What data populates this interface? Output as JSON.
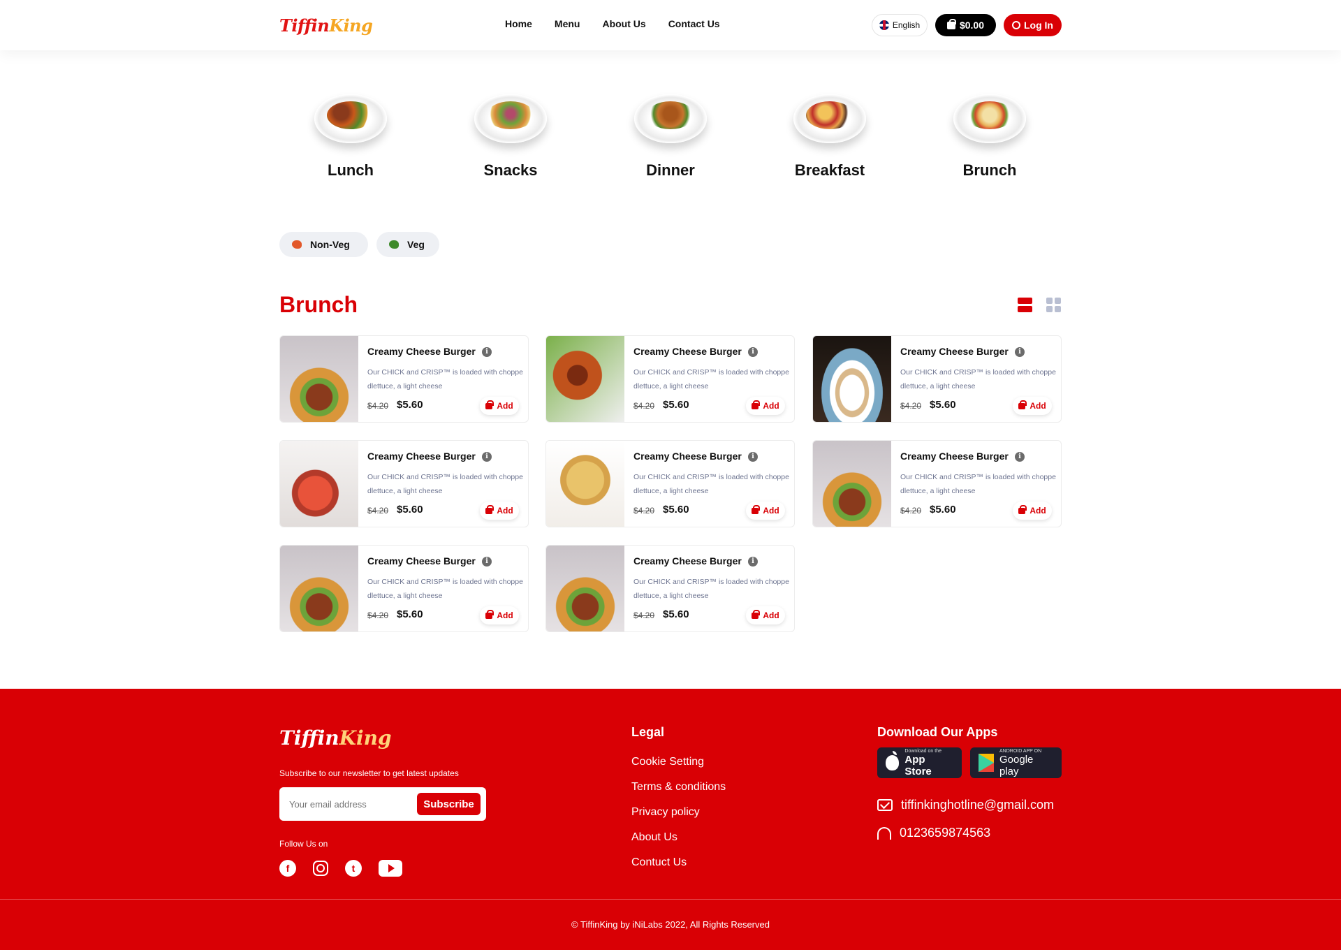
{
  "header": {
    "logo_part1": "Tiffin",
    "logo_part2": "King",
    "nav": [
      "Home",
      "Menu",
      "About Us",
      "Contact Us"
    ],
    "language": "English",
    "cart_total": "$0.00",
    "login": "Log In"
  },
  "categories": [
    "Lunch",
    "Snacks",
    "Dinner",
    "Breakfast",
    "Brunch"
  ],
  "filters": [
    "Non-Veg",
    "Veg"
  ],
  "section_title": "Brunch",
  "products": [
    {
      "name": "Creamy Cheese Burger",
      "desc": "Our CHICK and CRISP™ is loaded with choppe dlettuce, a light cheese",
      "old_price": "$4.20",
      "price": "$5.60",
      "add": "Add"
    },
    {
      "name": "Creamy Cheese Burger",
      "desc": "Our CHICK and CRISP™ is loaded with choppe dlettuce, a light cheese",
      "old_price": "$4.20",
      "price": "$5.60",
      "add": "Add"
    },
    {
      "name": "Creamy Cheese Burger",
      "desc": "Our CHICK and CRISP™ is loaded with choppe dlettuce, a light cheese",
      "old_price": "$4.20",
      "price": "$5.60",
      "add": "Add"
    },
    {
      "name": "Creamy Cheese Burger",
      "desc": "Our CHICK and CRISP™ is loaded with choppe dlettuce, a light cheese",
      "old_price": "$4.20",
      "price": "$5.60",
      "add": "Add"
    },
    {
      "name": "Creamy Cheese Burger",
      "desc": "Our CHICK and CRISP™ is loaded with choppe dlettuce, a light cheese",
      "old_price": "$4.20",
      "price": "$5.60",
      "add": "Add"
    },
    {
      "name": "Creamy Cheese Burger",
      "desc": "Our CHICK and CRISP™ is loaded with choppe dlettuce, a light cheese",
      "old_price": "$4.20",
      "price": "$5.60",
      "add": "Add"
    },
    {
      "name": "Creamy Cheese Burger",
      "desc": "Our CHICK and CRISP™ is loaded with choppe dlettuce, a light cheese",
      "old_price": "$4.20",
      "price": "$5.60",
      "add": "Add"
    },
    {
      "name": "Creamy Cheese Burger",
      "desc": "Our CHICK and CRISP™ is loaded with choppe dlettuce, a light cheese",
      "old_price": "$4.20",
      "price": "$5.60",
      "add": "Add"
    }
  ],
  "footer": {
    "newsletter_text": "Subscribe to our newsletter to get latest updates",
    "email_placeholder": "Your email address",
    "subscribe": "Subscribe",
    "follow": "Follow Us on",
    "legal_title": "Legal",
    "legal_links": [
      "Cookie Setting",
      "Terms & conditions",
      "Privacy policy",
      "About Us",
      "Contuct Us"
    ],
    "apps_title": "Download Our Apps",
    "app_store_small": "Download on the",
    "app_store": "App Store",
    "play_small": "ANDROID APP ON",
    "play": "Google play",
    "email": "tiffinkinghotline@gmail.com",
    "phone": "0123659874563",
    "copyright": "© TiffinKing by iNiLabs 2022, All Rights Reserved"
  },
  "colors": {
    "brand_red": "#d90005",
    "accent_gold": "#f5a623"
  }
}
